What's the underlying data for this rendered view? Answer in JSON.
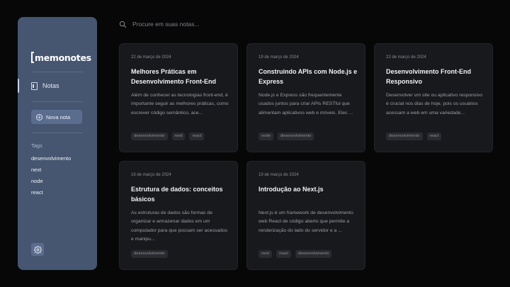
{
  "sidebar": {
    "logo": "memonotes",
    "nav": [
      {
        "label": "Notas",
        "icon": "notes-icon"
      }
    ],
    "new_note_label": "Nova nota",
    "tags_heading": "Tags",
    "tags": [
      "desenvolvimento",
      "next",
      "node",
      "react"
    ],
    "settings_icon": "gear-icon"
  },
  "search": {
    "placeholder": "Procure em suas notas..."
  },
  "notes": [
    {
      "date": "22 de março de 2024",
      "title": "Melhores Práticas em Desenvolvimento Front-End",
      "excerpt": "Além de conhecer as tecnologias front-end, é importante seguir as melhores práticas, como escrever código semântico, ace...",
      "tags": [
        "desenvolvimento",
        "next",
        "react"
      ]
    },
    {
      "date": "19 de março de 2024",
      "title": "Construindo APIs com Node.js e Express",
      "excerpt": "Node.js e Express são frequentemente usados juntos para criar APIs RESTful que alimentam aplicativos web e móveis. Eles ...",
      "tags": [
        "node",
        "desenvolvimento"
      ]
    },
    {
      "date": "22 de março de 2024",
      "title": "Desenvolvimento Front-End Responsivo",
      "excerpt": "Desenvolver um site ou aplicativo responsivo é crucial nos dias de hoje, pois os usuários acessam a web em uma variedade...",
      "tags": [
        "desenvolvimento",
        "react"
      ]
    },
    {
      "date": "16 de março de 2024",
      "title": "Estrutura de dados: conceitos básicos",
      "excerpt": "As estruturas de dados são formas de organizar e armazenar dados em um computador para que possam ser acessados e manipu...",
      "tags": [
        "desenvolvimento"
      ]
    },
    {
      "date": "19 de março de 2024",
      "title": "Introdução ao Next.js",
      "excerpt": "Next.js é um framework de desenvolvimento web React de código aberto que permite a renderização do lado do servidor e a ...",
      "tags": [
        "next",
        "react",
        "desenvolvimento"
      ]
    }
  ]
}
